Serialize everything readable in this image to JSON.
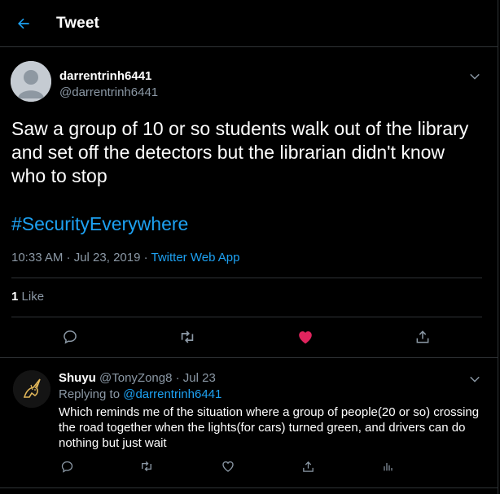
{
  "header": {
    "title": "Tweet",
    "back_icon": "arrow-left-icon"
  },
  "colors": {
    "accent": "#1da1f2",
    "like": "#e0245e",
    "muted": "#8b98a5",
    "background": "#000000"
  },
  "main_tweet": {
    "display_name": "darrentrinh6441",
    "handle": "@darrentrinh6441",
    "text": "Saw a group of 10 or so students walk out of the library and set off the detectors but the librarian didn't know who to stop",
    "hashtag": "#SecurityEverywhere",
    "timestamp": "10:33 AM · Jul 23, 2019 · ",
    "source": "Twitter Web App",
    "like_count": "1",
    "like_label": "Like",
    "liked": true
  },
  "reply": {
    "display_name": "Shuyu",
    "handle_date": "@TonyZong8 · Jul 23",
    "replying_prefix": "Replying to ",
    "replying_to": "@darrentrinh6441",
    "text": "Which reminds me of the situation where a group of people(20 or so) crossing the road together when the lights(for cars) turned green, and drivers can do nothing but just wait"
  }
}
